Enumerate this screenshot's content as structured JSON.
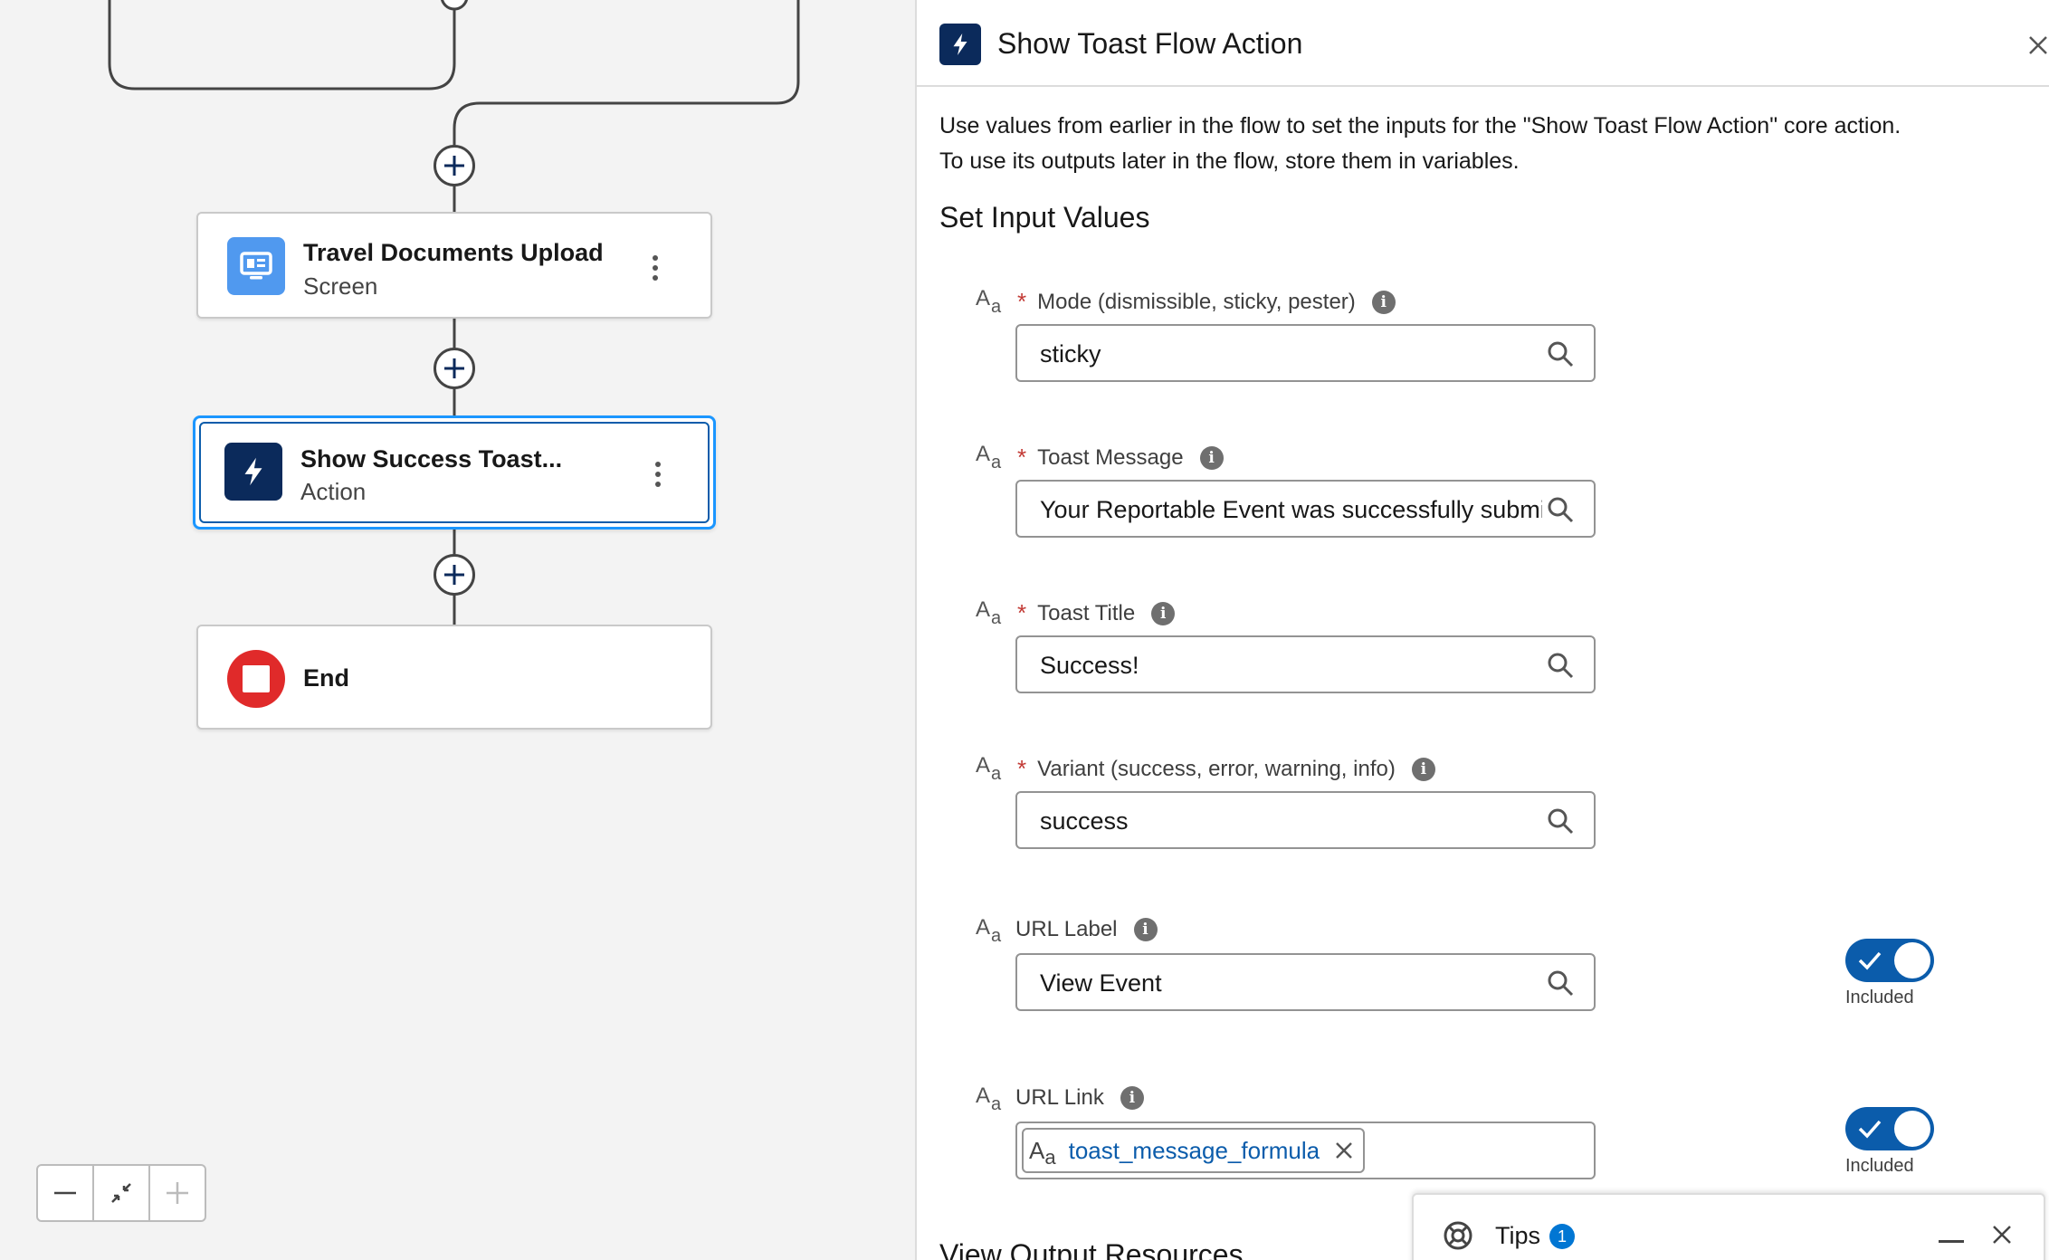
{
  "canvas": {
    "nodes": {
      "upload": {
        "title": "Travel Documents Upload",
        "subtitle": "Screen",
        "icon": "screen-icon",
        "icon_color": "#5099ef"
      },
      "action": {
        "title": "Show Success Toast...",
        "subtitle": "Action",
        "icon": "lightning-icon",
        "icon_color": "#0b2a5b",
        "selected": true
      },
      "end": {
        "title": "End",
        "icon": "stop-icon",
        "icon_color": "#e02a2a"
      }
    },
    "zoom_controls": [
      "zoom-out-icon",
      "fit-view-icon",
      "zoom-in-icon"
    ]
  },
  "panel": {
    "title": "Show Toast Flow Action",
    "description_line1": "Use values from earlier in the flow to set the inputs for the \"Show Toast Flow Action\" core action.",
    "description_line2": "To use its outputs later in the flow, store them in variables.",
    "section_title": "Set Input Values",
    "type_icon_text": {
      "big": "A",
      "small": "a"
    },
    "info_glyph": "i",
    "required_mark": "*",
    "fields": [
      {
        "label": "Mode (dismissible, sticky, pester)",
        "required": true,
        "value": "sticky"
      },
      {
        "label": "Toast Message",
        "required": true,
        "value": "Your Reportable Event was successfully submitted"
      },
      {
        "label": "Toast Title",
        "required": true,
        "value": "Success!"
      },
      {
        "label": "Variant (success, error, warning, info)",
        "required": true,
        "value": "success"
      },
      {
        "label": "URL Label",
        "required": false,
        "value": "View Event",
        "toggle": "Included"
      },
      {
        "label": "URL Link",
        "required": false,
        "pill": "toast_message_formula",
        "toggle": "Included"
      }
    ],
    "output_section_title": "View Output Resources"
  },
  "tips": {
    "label": "Tips",
    "count": "1"
  },
  "colors": {
    "brand": "#0b5cab",
    "required": "#c23934",
    "end": "#e02a2a",
    "screen": "#5099ef"
  }
}
